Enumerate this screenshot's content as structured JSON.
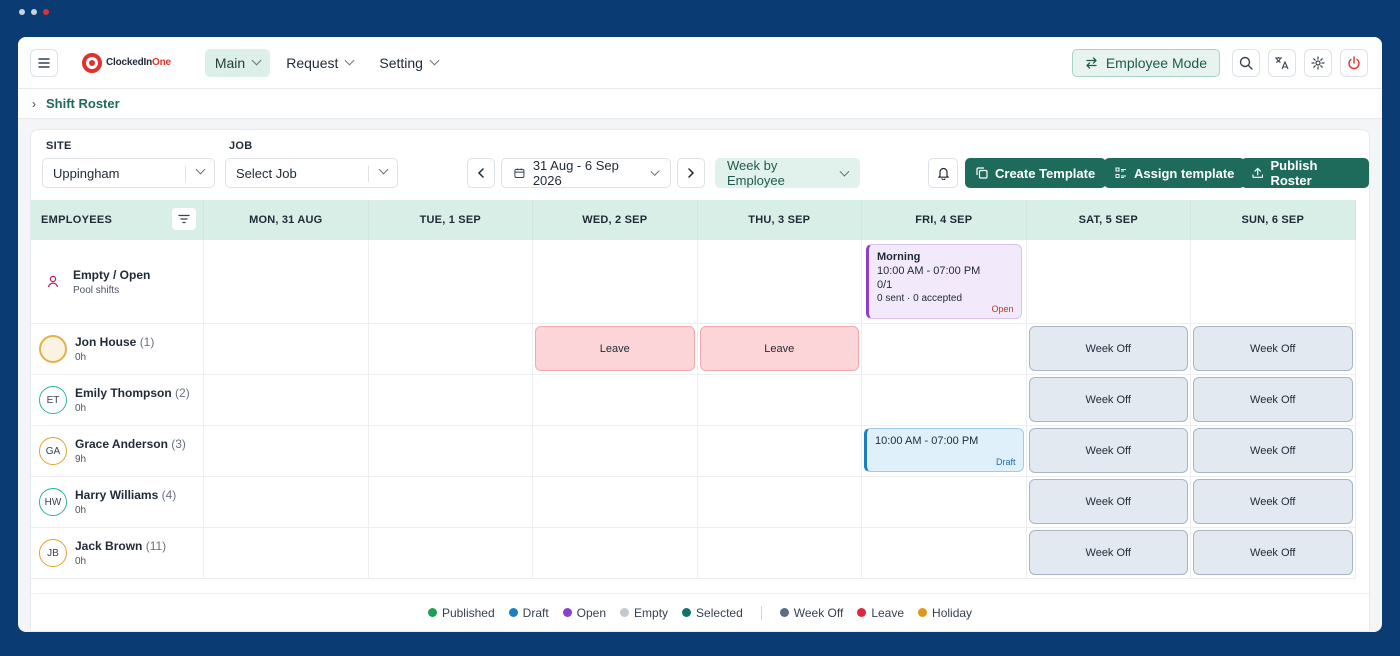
{
  "app": {
    "logo_prefix": "ClockedIn",
    "logo_suffix": "One"
  },
  "nav": [
    {
      "label": "Main",
      "active": true
    },
    {
      "label": "Request",
      "active": false
    },
    {
      "label": "Setting",
      "active": false
    }
  ],
  "header": {
    "employee_mode_label": "Employee Mode"
  },
  "breadcrumb": {
    "current": "Shift Roster"
  },
  "filters": {
    "site_label": "SITE",
    "site_value": "Uppingham",
    "job_label": "JOB",
    "job_value": "Select Job",
    "date_range": "31 Aug - 6 Sep 2026",
    "view_mode": "Week by Employee"
  },
  "actions": {
    "create_template": "Create Template",
    "assign_template": "Assign template",
    "publish_roster": "Publish Roster"
  },
  "grid": {
    "employees_header": "EMPLOYEES",
    "days": [
      "MON, 31 AUG",
      "TUE, 1 SEP",
      "WED, 2 SEP",
      "THU, 3 SEP",
      "FRI, 4 SEP",
      "SAT, 5 SEP",
      "SUN, 6 SEP"
    ]
  },
  "pool": {
    "name": "Empty / Open",
    "sub": "Pool shifts"
  },
  "open_shift": {
    "title": "Morning",
    "time": "10:00 AM - 07:00 PM",
    "fill": "0/1",
    "status_line": "0 sent · 0 accepted",
    "tag": "Open"
  },
  "employees": [
    {
      "name": "Jon House",
      "count": "(1)",
      "hours": "0h",
      "initials": "",
      "ring": "#e3b04b"
    },
    {
      "name": "Emily Thompson",
      "count": "(2)",
      "hours": "0h",
      "initials": "ET",
      "ring": "#2bb3a3"
    },
    {
      "name": "Grace Anderson",
      "count": "(3)",
      "hours": "9h",
      "initials": "GA",
      "ring": "#e3a12f"
    },
    {
      "name": "Harry Williams",
      "count": "(4)",
      "hours": "0h",
      "initials": "HW",
      "ring": "#2bb3a3"
    },
    {
      "name": "Jack Brown",
      "count": "(11)",
      "hours": "0h",
      "initials": "JB",
      "ring": "#e3a12f"
    }
  ],
  "tiles": {
    "leave": "Leave",
    "week_off": "Week Off"
  },
  "draft_shift": {
    "time": "10:00 AM - 07:00 PM",
    "tag": "Draft"
  },
  "legend": [
    {
      "label": "Published",
      "color": "#1e9e57"
    },
    {
      "label": "Draft",
      "color": "#1b7fbf"
    },
    {
      "label": "Open",
      "color": "#8a3fd1"
    },
    {
      "label": "Empty",
      "color": "#c4c9d0"
    },
    {
      "label": "Selected",
      "color": "#137266"
    },
    {
      "label": "Week Off",
      "color": "#5d6b83"
    },
    {
      "label": "Leave",
      "color": "#e0263d"
    },
    {
      "label": "Holiday",
      "color": "#d99a1b"
    }
  ]
}
